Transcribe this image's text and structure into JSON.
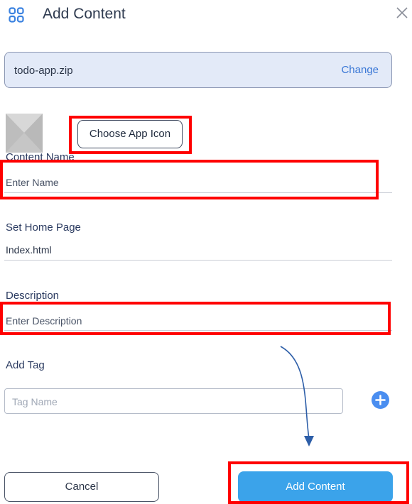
{
  "header": {
    "title": "Add Content",
    "icon": "grid-icon",
    "close_icon": "close-icon"
  },
  "file": {
    "name": "todo-app.zip",
    "change_label": "Change"
  },
  "app_icon": {
    "choose_label": "Choose App Icon"
  },
  "content_name": {
    "label": "Content Name",
    "placeholder": "Enter Name"
  },
  "home_page": {
    "label": "Set Home Page",
    "value": "Index.html"
  },
  "description": {
    "label": "Description",
    "placeholder": "Enter Description"
  },
  "tag": {
    "label": "Add Tag",
    "placeholder": "Tag Name",
    "add_icon": "plus-circle-icon"
  },
  "actions": {
    "cancel_label": "Cancel",
    "submit_label": "Add Content"
  },
  "colors": {
    "accent": "#3ba3ea",
    "link": "#3b78d6",
    "highlight": "#ff0000",
    "arrow": "#2d5ea8"
  }
}
